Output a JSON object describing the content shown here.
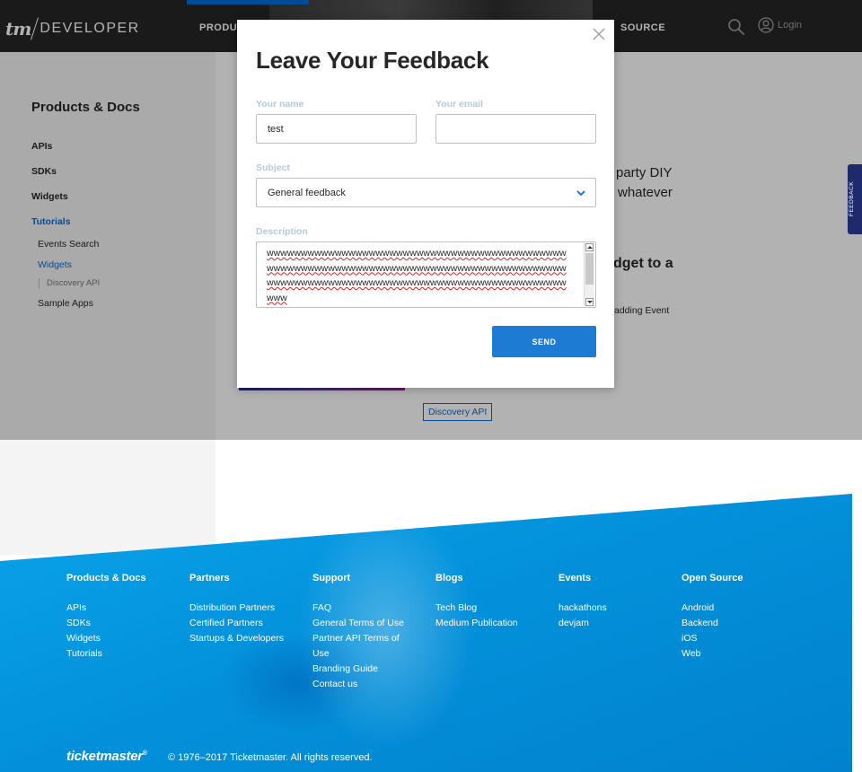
{
  "header": {
    "logo_tm": "tm",
    "logo_text": "DEVELOPER",
    "nav_left": "PRODUC",
    "nav_right": "SOURCE",
    "login_label": "Login",
    "icons": {
      "search": "search-icon",
      "login": "user-circle-icon"
    }
  },
  "sidebar": {
    "title": "Products & Docs",
    "items": [
      {
        "label": "APIs"
      },
      {
        "label": "SDKs"
      },
      {
        "label": "Widgets"
      },
      {
        "label": "Tutorials"
      }
    ],
    "sub_items": [
      {
        "label": "Events Search"
      },
      {
        "label": "Widgets"
      },
      {
        "label": "Discovery API"
      },
      {
        "label": "Sample Apps"
      }
    ]
  },
  "main": {
    "partial_line_1": "party DIY",
    "partial_line_2": "whatever",
    "partial_heading": "dget to a",
    "partial_small": "adding Event",
    "tag": "Discovery API"
  },
  "feedback_tab": {
    "label": "FEEDBACK"
  },
  "modal": {
    "title": "Leave Your Feedback",
    "name_label": "Your name",
    "name_value": "test",
    "email_label": "Your email",
    "email_value": "",
    "subject_label": "Subject",
    "subject_value": "General feedback",
    "description_label": "Description",
    "description_value": "wwwwwwwwwwwwwwwwwwwwwwwwwwwwwwwwwwwwwwwwwwwwwwwwwwwwwwwwwwwwwwwwwwwwwwwwwwwwwwwwwwwwwwwwwwwwwwwwwwwwwwwwwwwwwwwwwwwwwwwwwwwwwwwwwwwwwww",
    "send_label": "SEND",
    "icons": {
      "close": "close-icon",
      "chevron": "chevron-down-icon"
    }
  },
  "footer": {
    "columns": [
      {
        "heading": "Products & Docs",
        "links": [
          "APIs",
          "SDKs",
          "Widgets",
          "Tutorials"
        ]
      },
      {
        "heading": "Partners",
        "links": [
          "Distribution Partners",
          "Certified Partners",
          "Startups & Developers"
        ]
      },
      {
        "heading": "Support",
        "links": [
          "FAQ",
          "General Terms of Use",
          "Partner API Terms of",
          "Use",
          "Branding Guide",
          "Contact us"
        ]
      },
      {
        "heading": "Blogs",
        "links": [
          "Tech Blog",
          "Medium Publication"
        ]
      },
      {
        "heading": "Events",
        "links": [
          "hackathons",
          "devjam"
        ]
      },
      {
        "heading": "Open Source",
        "links": [
          "Android",
          "Backend",
          "iOS",
          "Web"
        ]
      }
    ],
    "brand": "ticketmaster",
    "brand_mark": "®",
    "copyright": "© 1976–2017 Ticketmaster. All rights reserved."
  },
  "colors": {
    "accent": "#026cdf",
    "header_bg": "#262626",
    "footer_blue": "#0391db",
    "send_button": "#1e7bd3",
    "label_gray": "#b7c9d6"
  }
}
